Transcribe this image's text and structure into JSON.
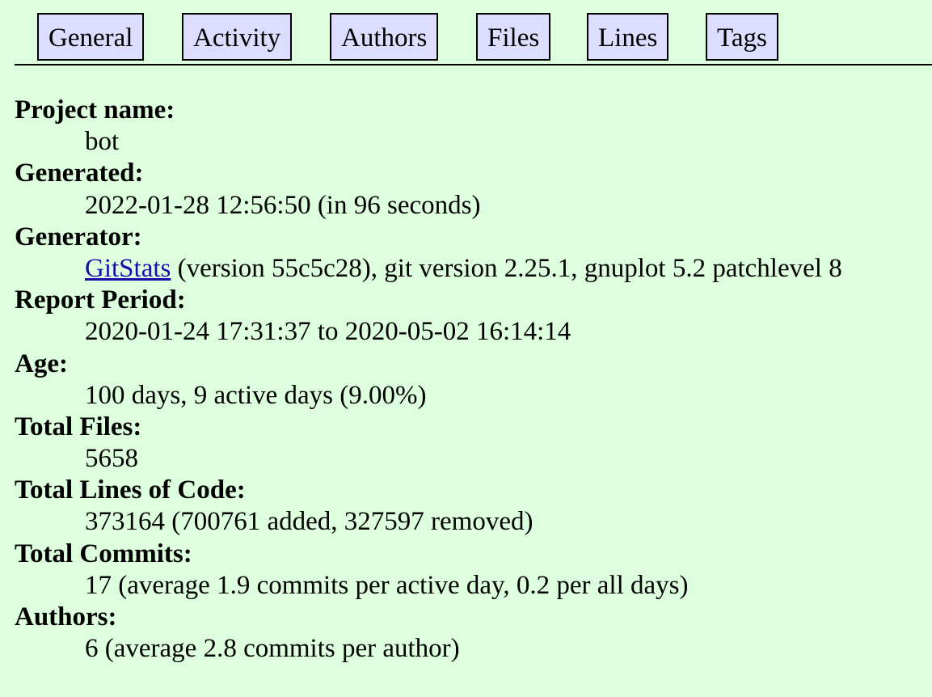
{
  "nav": {
    "tabs": [
      {
        "label": "General"
      },
      {
        "label": "Activity"
      },
      {
        "label": "Authors"
      },
      {
        "label": "Files"
      },
      {
        "label": "Lines"
      },
      {
        "label": "Tags"
      }
    ]
  },
  "stats": {
    "project_name": {
      "label": "Project name:",
      "value": "bot"
    },
    "generated": {
      "label": "Generated:",
      "value": "2022-01-28 12:56:50 (in 96 seconds)"
    },
    "generator": {
      "label": "Generator:",
      "link_text": "GitStats",
      "value_rest": " (version 55c5c28), git version 2.25.1, gnuplot 5.2 patchlevel 8"
    },
    "report_period": {
      "label": "Report Period:",
      "value": "2020-01-24 17:31:37 to 2020-05-02 16:14:14"
    },
    "age": {
      "label": "Age:",
      "value": "100 days, 9 active days (9.00%)"
    },
    "total_files": {
      "label": "Total Files:",
      "value": "5658"
    },
    "total_lines": {
      "label": "Total Lines of Code:",
      "value": "373164 (700761 added, 327597 removed)"
    },
    "total_commits": {
      "label": "Total Commits:",
      "value": "17 (average 1.9 commits per active day, 0.2 per all days)"
    },
    "authors": {
      "label": "Authors:",
      "value": "6 (average 2.8 commits per author)"
    }
  }
}
